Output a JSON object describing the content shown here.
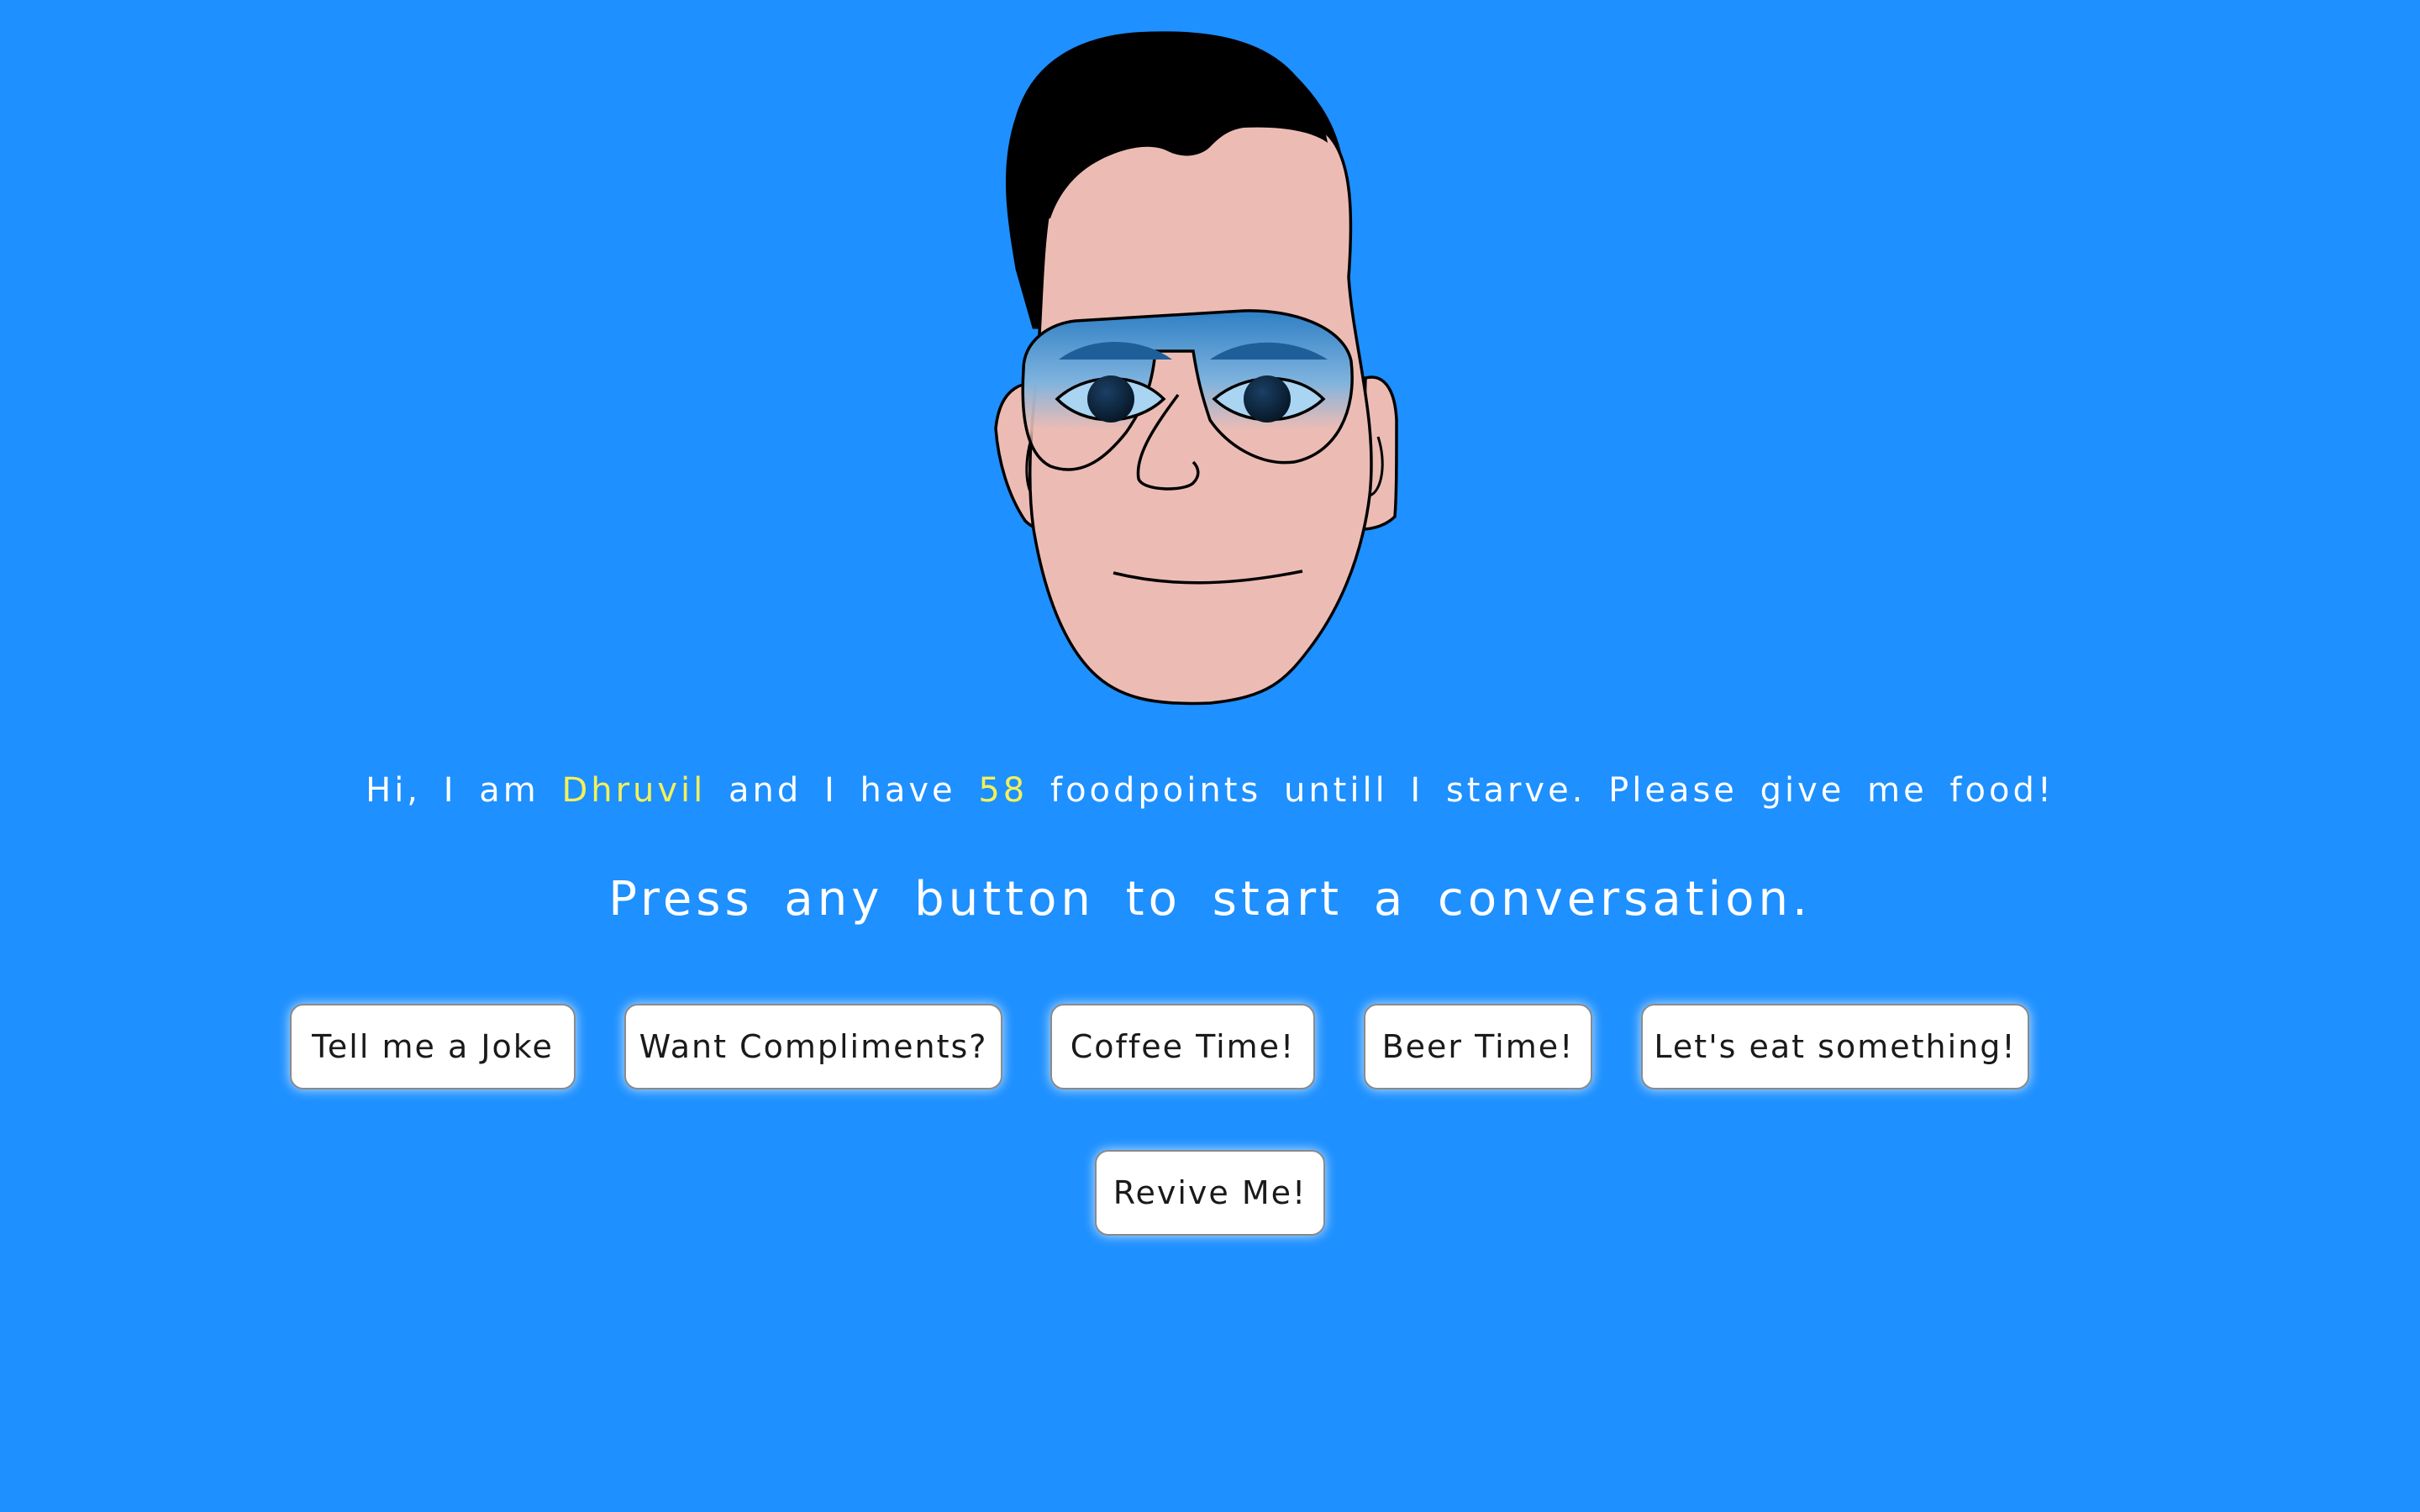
{
  "colors": {
    "background": "#1e90ff",
    "highlight": "#f5f05a",
    "text": "#ffffff",
    "button_bg": "#ffffff",
    "skin": "#ecbcb4",
    "hair": "#000000"
  },
  "status": {
    "prefix": "Hi, I am ",
    "name": "Dhruvil",
    "middle": " and I have ",
    "foodpoints": "58",
    "suffix": " foodpoints untill I starve. Please give me food!"
  },
  "prompt": "Press any button to start a conversation.",
  "buttons": {
    "joke": "Tell me a Joke",
    "compliments": "Want Compliments?",
    "coffee": "Coffee Time!",
    "beer": "Beer Time!",
    "eat": "Let's eat something!",
    "revive": "Revive Me!"
  },
  "avatar": {
    "icon": "cartoon-face-with-sunglasses-icon"
  }
}
